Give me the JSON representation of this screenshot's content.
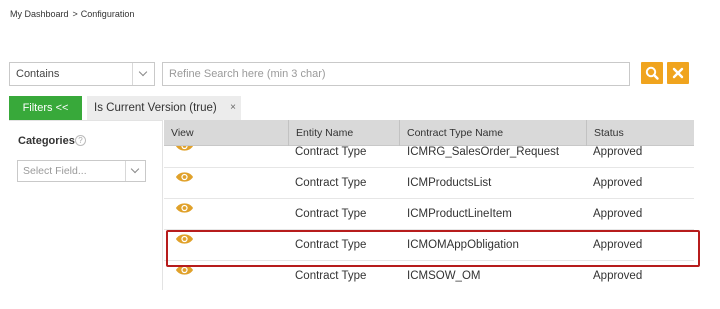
{
  "breadcrumb": {
    "home": "My Dashboard",
    "separator": ">",
    "current": "Configuration"
  },
  "search": {
    "match_mode": "Contains",
    "placeholder": "Refine Search here (min 3 char)",
    "value": ""
  },
  "filters": {
    "toggle_label": "Filters <<",
    "active_tag": "Is Current Version (true)",
    "remove_glyph": "×"
  },
  "categories": {
    "label": "Categories",
    "help_glyph": "?",
    "field_placeholder": "Select Field..."
  },
  "table": {
    "columns": [
      "View",
      "Entity Name",
      "Contract Type Name",
      "Status"
    ],
    "rows": [
      {
        "entity": "Contract Type",
        "name": "ICMRG_SalesOrder_Request",
        "status": "Approved"
      },
      {
        "entity": "Contract Type",
        "name": "ICMProductsList",
        "status": "Approved"
      },
      {
        "entity": "Contract Type",
        "name": "ICMProductLineItem",
        "status": "Approved"
      },
      {
        "entity": "Contract Type",
        "name": "ICMOMAppObligation",
        "status": "Approved"
      },
      {
        "entity": "Contract Type",
        "name": "ICMSOW_OM",
        "status": "Approved"
      }
    ],
    "highlighted_row": 3
  },
  "colors": {
    "accent_orange": "#f0a41e",
    "filters_green": "#38a93a",
    "highlight_red": "#b71c1c",
    "eye_icon": "#e0a12a"
  },
  "icons": {
    "search_button": "magnifier-icon",
    "clear_button": "close-x-icon",
    "view": "eye-icon",
    "dropdown": "chevron-down-icon",
    "help": "question-circle-icon"
  }
}
